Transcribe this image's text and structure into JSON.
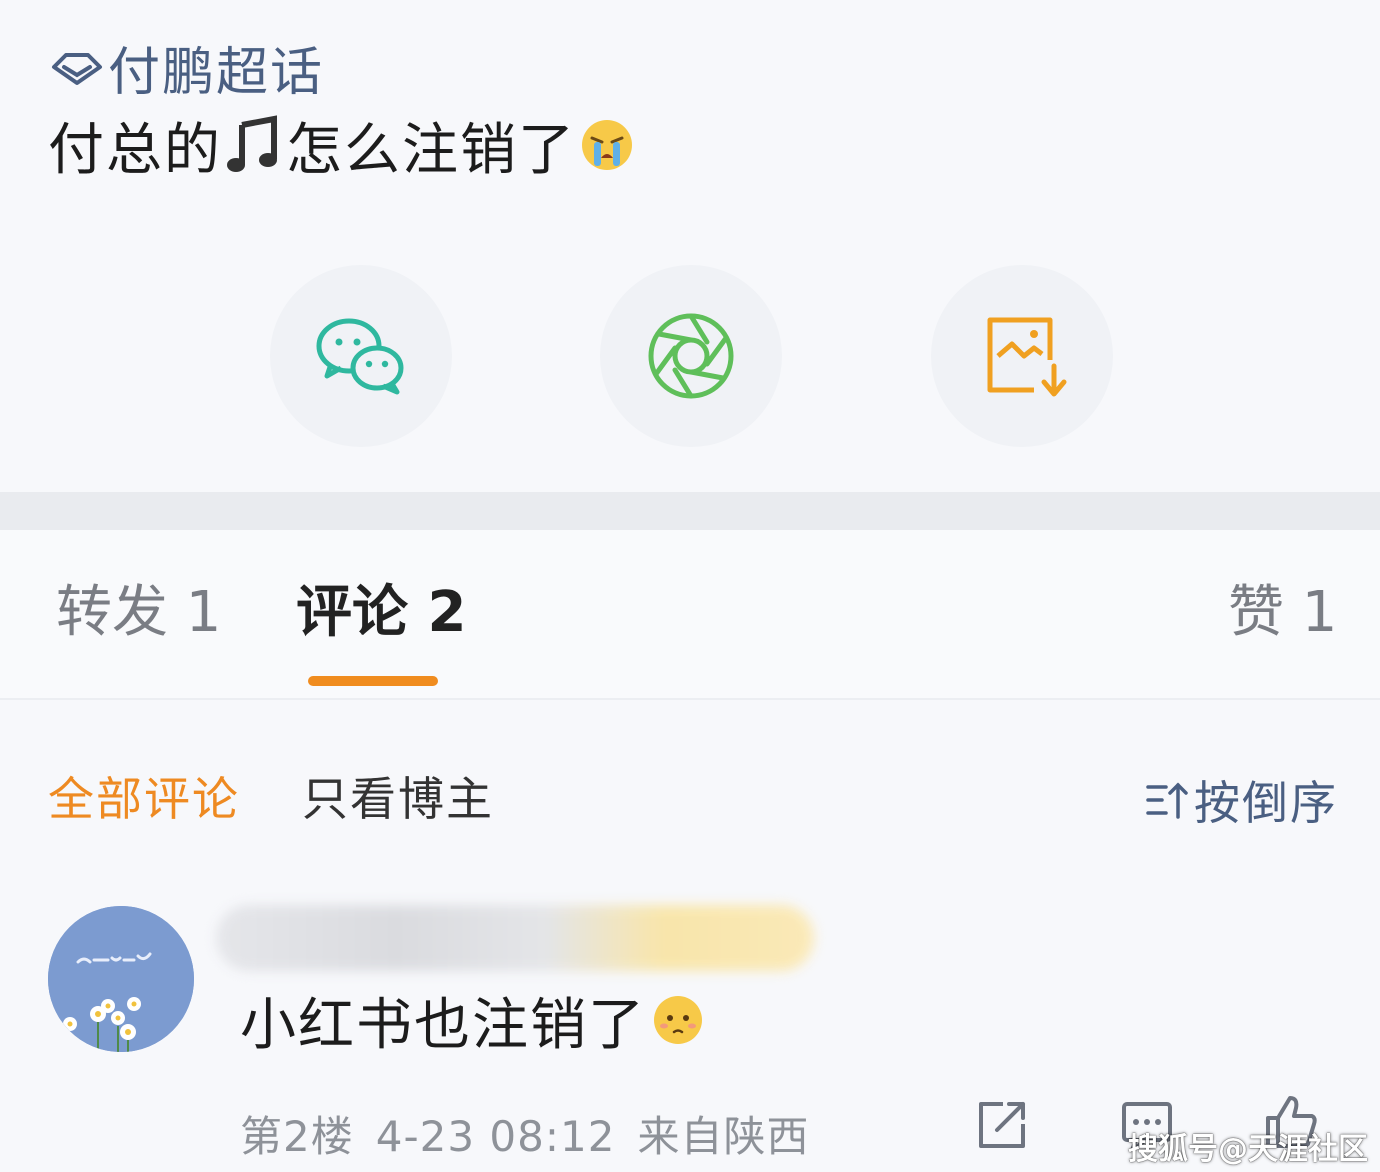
{
  "post": {
    "topic": "付鹏超话",
    "text_before": "付总的",
    "text_after": "怎么注销了"
  },
  "share": {
    "wechat_icon": "wechat-icon",
    "moments_icon": "moments-icon",
    "save_icon": "save-image-icon"
  },
  "tabs": {
    "repost": "转发 1",
    "comments": "评论 2",
    "likes": "赞 1"
  },
  "filters": {
    "all": "全部评论",
    "author_only": "只看博主",
    "sort": "按倒序"
  },
  "comment": {
    "text": "小红书也注销了",
    "floor": "第2楼",
    "time": "4-23 08:12",
    "location": "来自陕西"
  },
  "watermark": "搜狐号@天涯社区",
  "colors": {
    "accent": "#f08c1f",
    "link": "#4a5f82",
    "wechat": "#2fb89f",
    "moments": "#5fbf5a",
    "save": "#f0a020"
  }
}
